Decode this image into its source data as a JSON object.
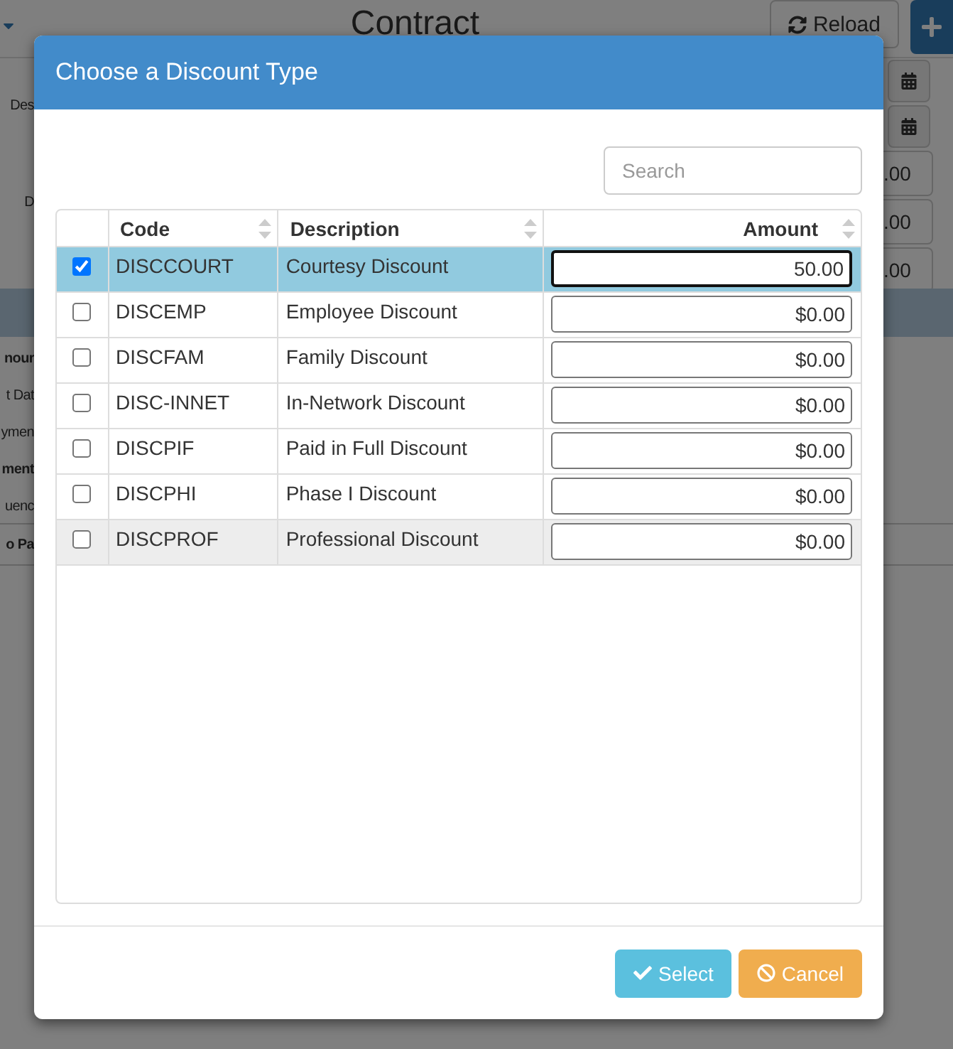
{
  "page": {
    "title": "Contract",
    "reload_label": "Reload",
    "left_labels": [
      {
        "text": "Des",
        "bold": false
      },
      {
        "text": "D",
        "bold": false
      }
    ],
    "section_labels": [
      {
        "text": "nour",
        "bold": true
      },
      {
        "text": "t Dat",
        "bold": false
      },
      {
        "text": "ymen",
        "bold": false
      },
      {
        "text": "ment",
        "bold": true
      },
      {
        "text": "uenc",
        "bold": false
      }
    ],
    "footer_label": "o Pa",
    "right_fields": [
      {
        "kind": "calendar"
      },
      {
        "kind": "calendar"
      },
      {
        "kind": "amount",
        "value": ".00"
      },
      {
        "kind": "amount",
        "value": ".00"
      },
      {
        "kind": "amount",
        "value": ".00"
      }
    ]
  },
  "dialog": {
    "title": "Choose a Discount Type",
    "search": {
      "placeholder": "Search"
    },
    "columns": [
      {
        "label": "Code",
        "sortable": true
      },
      {
        "label": "Description",
        "sortable": true
      },
      {
        "label": "Amount",
        "sortable": true
      }
    ],
    "rows": [
      {
        "code": "DISCCOURT",
        "description": "Courtesy Discount",
        "amount": "50.00",
        "checked": true,
        "selected": true,
        "focused": true,
        "hovered": false
      },
      {
        "code": "DISCEMP",
        "description": "Employee Discount",
        "amount": "$0.00",
        "checked": false,
        "selected": false,
        "focused": false,
        "hovered": false
      },
      {
        "code": "DISCFAM",
        "description": "Family Discount",
        "amount": "$0.00",
        "checked": false,
        "selected": false,
        "focused": false,
        "hovered": false
      },
      {
        "code": "DISC-INNET",
        "description": "In-Network Discount",
        "amount": "$0.00",
        "checked": false,
        "selected": false,
        "focused": false,
        "hovered": false
      },
      {
        "code": "DISCPIF",
        "description": "Paid in Full Discount",
        "amount": "$0.00",
        "checked": false,
        "selected": false,
        "focused": false,
        "hovered": false
      },
      {
        "code": "DISCPHI",
        "description": "Phase I Discount",
        "amount": "$0.00",
        "checked": false,
        "selected": false,
        "focused": false,
        "hovered": false
      },
      {
        "code": "DISCPROF",
        "description": "Professional Discount",
        "amount": "$0.00",
        "checked": false,
        "selected": false,
        "focused": false,
        "hovered": true
      }
    ],
    "buttons": [
      {
        "kind": "select",
        "label": "Select"
      },
      {
        "kind": "cancel",
        "label": "Cancel"
      }
    ]
  }
}
